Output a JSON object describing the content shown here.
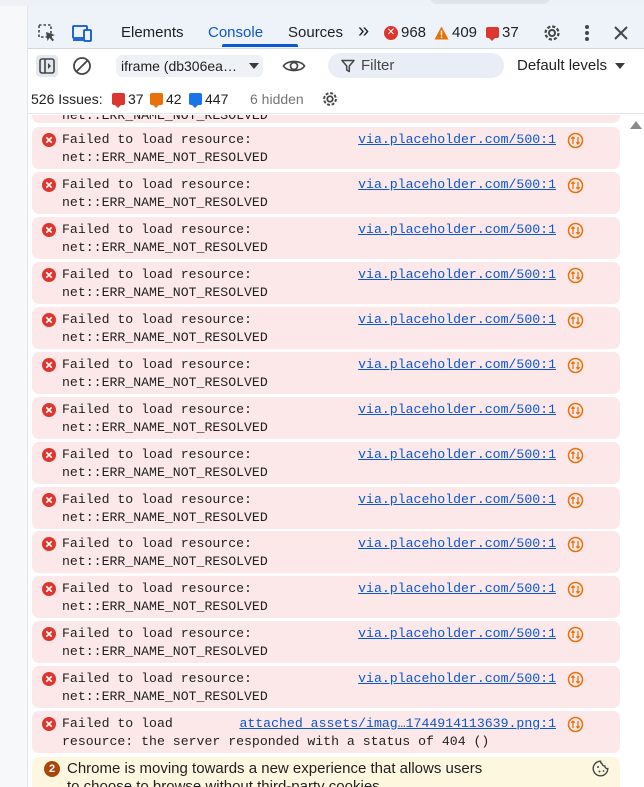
{
  "devtools": {
    "tabs": [
      {
        "label": "Elements",
        "active": false
      },
      {
        "label": "Console",
        "active": true
      },
      {
        "label": "Sources",
        "active": false
      }
    ],
    "more_tabs_label": "»",
    "counts": {
      "errors": "968",
      "warnings": "409",
      "issues": "37"
    },
    "accent_color": "#0b57d0",
    "error_color": "#dc362e"
  },
  "toolbar": {
    "context_select": "iframe (db306ea…",
    "filter_placeholder": "Filter",
    "levels_label": "Default levels"
  },
  "issues_bar": {
    "total_label": "526 Issues:",
    "errors": "37",
    "warnings": "42",
    "info": "447",
    "hidden_label": "6 hidden"
  },
  "messages": {
    "partial_top": "net::ERR_NAME_NOT_RESOLVED",
    "errors": [
      {
        "line1": "Failed to load resource:",
        "line2": "net::ERR_NAME_NOT_RESOLVED",
        "source": "via.placeholder.com/500:1"
      },
      {
        "line1": "Failed to load resource:",
        "line2": "net::ERR_NAME_NOT_RESOLVED",
        "source": "via.placeholder.com/500:1"
      },
      {
        "line1": "Failed to load resource:",
        "line2": "net::ERR_NAME_NOT_RESOLVED",
        "source": "via.placeholder.com/500:1"
      },
      {
        "line1": "Failed to load resource:",
        "line2": "net::ERR_NAME_NOT_RESOLVED",
        "source": "via.placeholder.com/500:1"
      },
      {
        "line1": "Failed to load resource:",
        "line2": "net::ERR_NAME_NOT_RESOLVED",
        "source": "via.placeholder.com/500:1"
      },
      {
        "line1": "Failed to load resource:",
        "line2": "net::ERR_NAME_NOT_RESOLVED",
        "source": "via.placeholder.com/500:1"
      },
      {
        "line1": "Failed to load resource:",
        "line2": "net::ERR_NAME_NOT_RESOLVED",
        "source": "via.placeholder.com/500:1"
      },
      {
        "line1": "Failed to load resource:",
        "line2": "net::ERR_NAME_NOT_RESOLVED",
        "source": "via.placeholder.com/500:1"
      },
      {
        "line1": "Failed to load resource:",
        "line2": "net::ERR_NAME_NOT_RESOLVED",
        "source": "via.placeholder.com/500:1"
      },
      {
        "line1": "Failed to load resource:",
        "line2": "net::ERR_NAME_NOT_RESOLVED",
        "source": "via.placeholder.com/500:1"
      },
      {
        "line1": "Failed to load resource:",
        "line2": "net::ERR_NAME_NOT_RESOLVED",
        "source": "via.placeholder.com/500:1"
      },
      {
        "line1": "Failed to load resource:",
        "line2": "net::ERR_NAME_NOT_RESOLVED",
        "source": "via.placeholder.com/500:1"
      },
      {
        "line1": "Failed to load resource:",
        "line2": "net::ERR_NAME_NOT_RESOLVED",
        "source": "via.placeholder.com/500:1"
      }
    ],
    "error_404": {
      "line1": "Failed to load",
      "line2": "resource: the server responded with a status of 404 ()",
      "source": "attached_assets/imag…1744914113639.png:1"
    },
    "warning": {
      "count": "2",
      "line1": "Chrome is moving towards a new experience that allows users",
      "line2": "to choose to browse without third-party cookies."
    }
  }
}
